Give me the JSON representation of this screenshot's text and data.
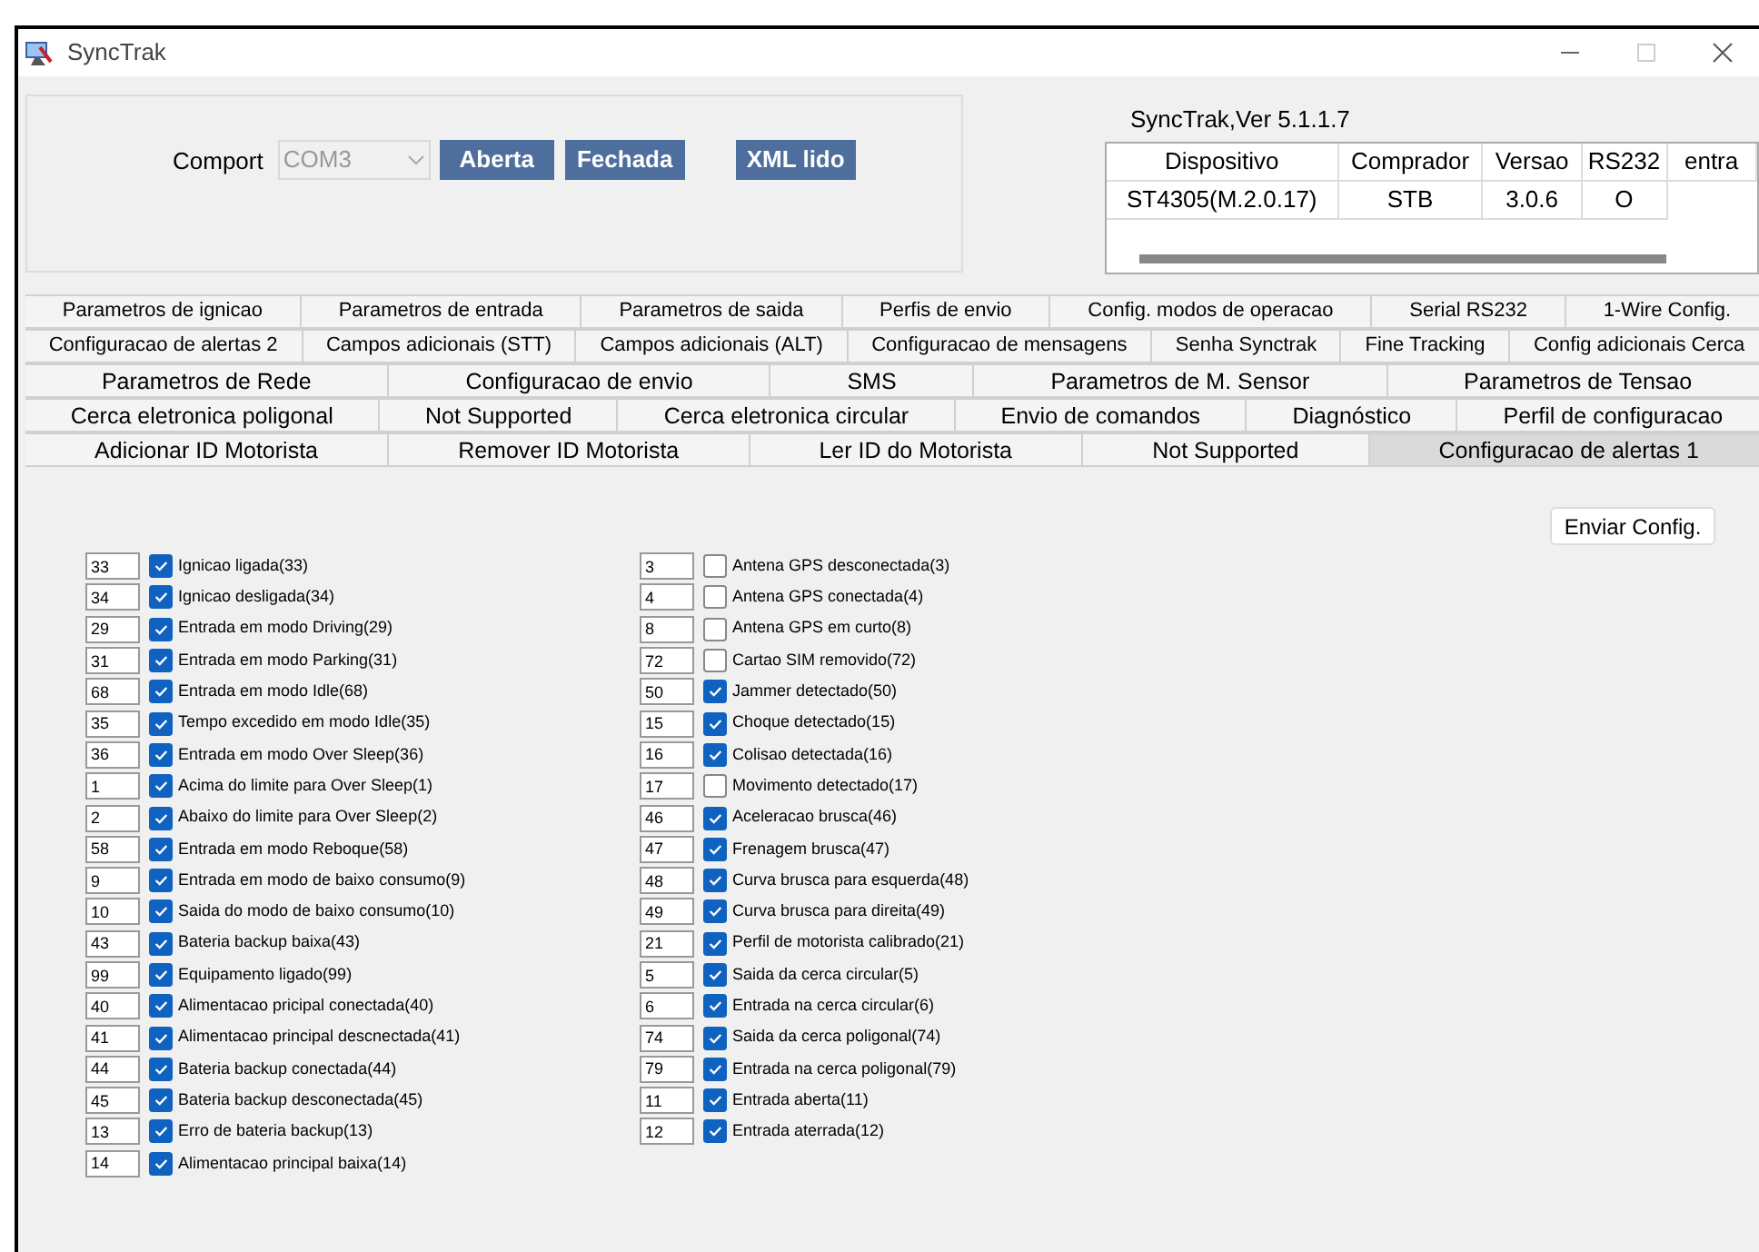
{
  "window": {
    "title": "SyncTrak"
  },
  "connection": {
    "label": "Comport",
    "port": "COM3",
    "buttons": [
      "Aberta",
      "Fechada",
      "XML lido"
    ]
  },
  "device_info": {
    "version": "SyncTrak,Ver 5.1.1.7",
    "columns": [
      "Dispositivo",
      "Comprador",
      "Versao",
      "RS232",
      "entra"
    ],
    "rows": [
      [
        "ST4305(M.2.0.17)",
        "STB",
        "3.0.6",
        "O"
      ]
    ]
  },
  "tab_rows": [
    [
      {
        "label": "Parametros de ignicao",
        "selected": false
      },
      {
        "label": "Parametros de entrada",
        "selected": false
      },
      {
        "label": "Parametros de saida",
        "selected": false
      },
      {
        "label": "Perfis de envio",
        "selected": false
      },
      {
        "label": "Config. modos de operacao",
        "selected": false
      },
      {
        "label": "Serial RS232",
        "selected": false
      },
      {
        "label": "1-Wire Config.",
        "selected": false
      }
    ],
    [
      {
        "label": "Configuracao de alertas 2",
        "selected": false
      },
      {
        "label": "Campos adicionais (STT)",
        "selected": false
      },
      {
        "label": "Campos adicionais (ALT)",
        "selected": false
      },
      {
        "label": "Configuracao de mensagens",
        "selected": false
      },
      {
        "label": "Senha Synctrak",
        "selected": false
      },
      {
        "label": "Fine Tracking",
        "selected": false
      },
      {
        "label": "Config adicionais Cerca",
        "selected": false
      }
    ],
    [
      {
        "label": "Parametros de Rede",
        "selected": false
      },
      {
        "label": "Configuracao de envio",
        "selected": false
      },
      {
        "label": "SMS",
        "selected": false
      },
      {
        "label": "Parametros de M. Sensor",
        "selected": false
      },
      {
        "label": "Parametros de Tensao",
        "selected": false
      }
    ],
    [
      {
        "label": "Cerca eletronica poligonal",
        "selected": false
      },
      {
        "label": "Not Supported",
        "selected": false
      },
      {
        "label": "Cerca eletronica circular",
        "selected": false
      },
      {
        "label": "Envio de comandos",
        "selected": false
      },
      {
        "label": "Diagnóstico",
        "selected": false
      },
      {
        "label": "Perfil de configuracao",
        "selected": false
      }
    ],
    [
      {
        "label": "Adicionar ID Motorista",
        "selected": false
      },
      {
        "label": "Remover ID Motorista",
        "selected": false
      },
      {
        "label": "Ler ID do Motorista",
        "selected": false
      },
      {
        "label": "Not Supported",
        "selected": false
      },
      {
        "label": "Configuracao de alertas 1",
        "selected": true
      }
    ]
  ],
  "send_button": "Enviar Config.",
  "alert_columns": [
    [
      {
        "code": "33",
        "label": "Ignicao ligada(33)",
        "checked": true
      },
      {
        "code": "34",
        "label": "Ignicao desligada(34)",
        "checked": true
      },
      {
        "code": "29",
        "label": "Entrada em modo Driving(29)",
        "checked": true
      },
      {
        "code": "31",
        "label": "Entrada em modo Parking(31)",
        "checked": true
      },
      {
        "code": "68",
        "label": "Entrada em modo Idle(68)",
        "checked": true
      },
      {
        "code": "35",
        "label": "Tempo excedido em modo Idle(35)",
        "checked": true
      },
      {
        "code": "36",
        "label": "Entrada em modo Over Sleep(36)",
        "checked": true
      },
      {
        "code": "1",
        "label": "Acima do limite para Over Sleep(1)",
        "checked": true
      },
      {
        "code": "2",
        "label": "Abaixo do limite para Over Sleep(2)",
        "checked": true
      },
      {
        "code": "58",
        "label": "Entrada em modo Reboque(58)",
        "checked": true
      },
      {
        "code": "9",
        "label": "Entrada em modo de baixo consumo(9)",
        "checked": true
      },
      {
        "code": "10",
        "label": "Saida do modo de baixo consumo(10)",
        "checked": true
      },
      {
        "code": "43",
        "label": "Bateria backup baixa(43)",
        "checked": true
      },
      {
        "code": "99",
        "label": "Equipamento ligado(99)",
        "checked": true
      },
      {
        "code": "40",
        "label": "Alimentacao pricipal conectada(40)",
        "checked": true
      },
      {
        "code": "41",
        "label": "Alimentacao principal descnectada(41)",
        "checked": true
      },
      {
        "code": "44",
        "label": "Bateria backup conectada(44)",
        "checked": true
      },
      {
        "code": "45",
        "label": "Bateria backup desconectada(45)",
        "checked": true
      },
      {
        "code": "13",
        "label": "Erro de bateria backup(13)",
        "checked": true
      },
      {
        "code": "14",
        "label": "Alimentacao principal baixa(14)",
        "checked": true
      }
    ],
    [
      {
        "code": "3",
        "label": "Antena GPS desconectada(3)",
        "checked": false
      },
      {
        "code": "4",
        "label": "Antena GPS conectada(4)",
        "checked": false
      },
      {
        "code": "8",
        "label": "Antena GPS em curto(8)",
        "checked": false
      },
      {
        "code": "72",
        "label": "Cartao SIM removido(72)",
        "checked": false
      },
      {
        "code": "50",
        "label": "Jammer detectado(50)",
        "checked": true
      },
      {
        "code": "15",
        "label": "Choque detectado(15)",
        "checked": true
      },
      {
        "code": "16",
        "label": "Colisao detectada(16)",
        "checked": true
      },
      {
        "code": "17",
        "label": "Movimento detectado(17)",
        "checked": false
      },
      {
        "code": "46",
        "label": "Aceleracao brusca(46)",
        "checked": true
      },
      {
        "code": "47",
        "label": "Frenagem brusca(47)",
        "checked": true
      },
      {
        "code": "48",
        "label": "Curva brusca para esquerda(48)",
        "checked": true
      },
      {
        "code": "49",
        "label": "Curva brusca para direita(49)",
        "checked": true
      },
      {
        "code": "21",
        "label": "Perfil de motorista calibrado(21)",
        "checked": true
      },
      {
        "code": "5",
        "label": "Saida da cerca circular(5)",
        "checked": true
      },
      {
        "code": "6",
        "label": "Entrada na cerca circular(6)",
        "checked": true
      },
      {
        "code": "74",
        "label": "Saida da cerca poligonal(74)",
        "checked": true
      },
      {
        "code": "79",
        "label": "Entrada na cerca poligonal(79)",
        "checked": true
      },
      {
        "code": "11",
        "label": "Entrada aberta(11)",
        "checked": true
      },
      {
        "code": "12",
        "label": "Entrada aterrada(12)",
        "checked": true
      }
    ]
  ]
}
